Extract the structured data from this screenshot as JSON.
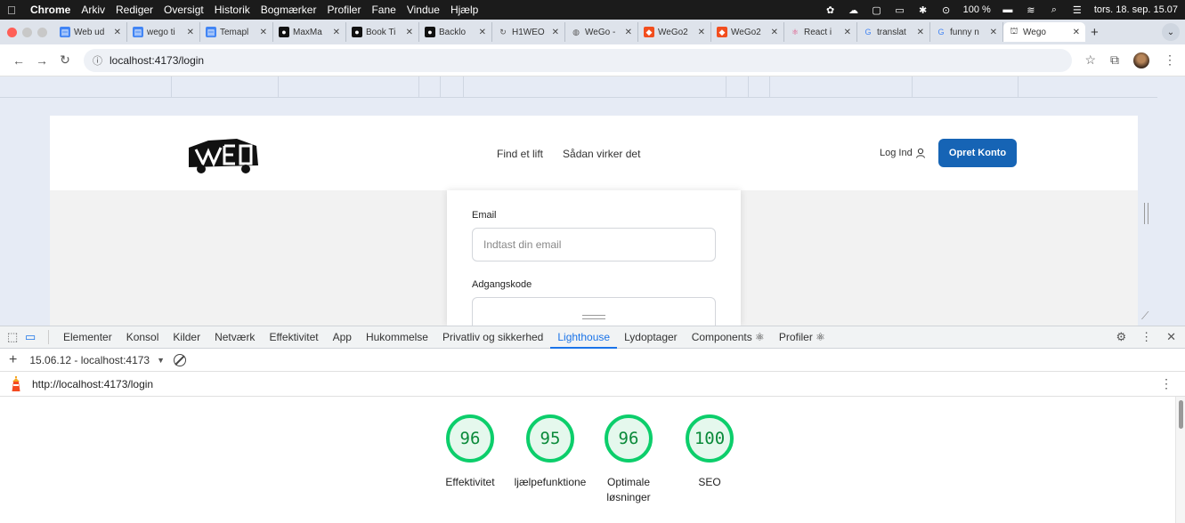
{
  "menubar": {
    "app": "Chrome",
    "items": [
      "Arkiv",
      "Rediger",
      "Oversigt",
      "Historik",
      "Bogmærker",
      "Profiler",
      "Fane",
      "Vindue",
      "Hjælp"
    ],
    "battery": "100 %",
    "datetime": "tors. 18. sep. 15.07"
  },
  "tabs": [
    {
      "label": "Web ud",
      "icon": "docs-icon",
      "color": "#4285f4"
    },
    {
      "label": "wego ti",
      "icon": "docs-icon",
      "color": "#4285f4"
    },
    {
      "label": "Temapl",
      "icon": "docs-icon",
      "color": "#4285f4"
    },
    {
      "label": "MaxMa",
      "icon": "github-icon",
      "color": "#111111"
    },
    {
      "label": "Book Ti",
      "icon": "github-icon",
      "color": "#111111"
    },
    {
      "label": "Backlo",
      "icon": "github-icon",
      "color": "#111111"
    },
    {
      "label": "H1WEO",
      "icon": "refresh-icon",
      "color": "#555555"
    },
    {
      "label": "WeGo -",
      "icon": "globe-icon",
      "color": "#555555"
    },
    {
      "label": "WeGo2",
      "icon": "figma-icon",
      "color": "#f24e1e"
    },
    {
      "label": "WeGo2",
      "icon": "figma-icon",
      "color": "#f24e1e"
    },
    {
      "label": "React i",
      "icon": "react-icon",
      "color": "#e0457b"
    },
    {
      "label": "translat",
      "icon": "google-icon",
      "color": "#4285f4"
    },
    {
      "label": "funny n",
      "icon": "google-icon",
      "color": "#4285f4"
    }
  ],
  "active_tab": {
    "label": "Wego",
    "icon": "car-icon"
  },
  "address": {
    "url": "localhost:4173/login"
  },
  "site": {
    "nav": [
      "Find et lift",
      "Sådan virker det"
    ],
    "login": "Log Ind",
    "signup": "Opret Konto",
    "email_label": "Email",
    "email_placeholder": "Indtast din email",
    "password_label": "Adgangskode",
    "accent_color": "#1664b5"
  },
  "devtools": {
    "tabs": [
      "Elementer",
      "Konsol",
      "Kilder",
      "Netværk",
      "Effektivitet",
      "App",
      "Hukommelse",
      "Privatliv og sikkerhed",
      "Lighthouse",
      "Lydoptager",
      "Components ⚛",
      "Profiler ⚛"
    ],
    "active": "Lighthouse",
    "report_select": "15.06.12 - localhost:4173",
    "report_url": "http://localhost:4173/login",
    "scores": [
      {
        "value": "96",
        "label": "Effektivitet"
      },
      {
        "value": "95",
        "label": "ljælpefunktione"
      },
      {
        "value": "96",
        "label": "Optimale\nløsninger"
      },
      {
        "value": "100",
        "label": "SEO"
      }
    ],
    "score_color": "#0cce6b"
  }
}
